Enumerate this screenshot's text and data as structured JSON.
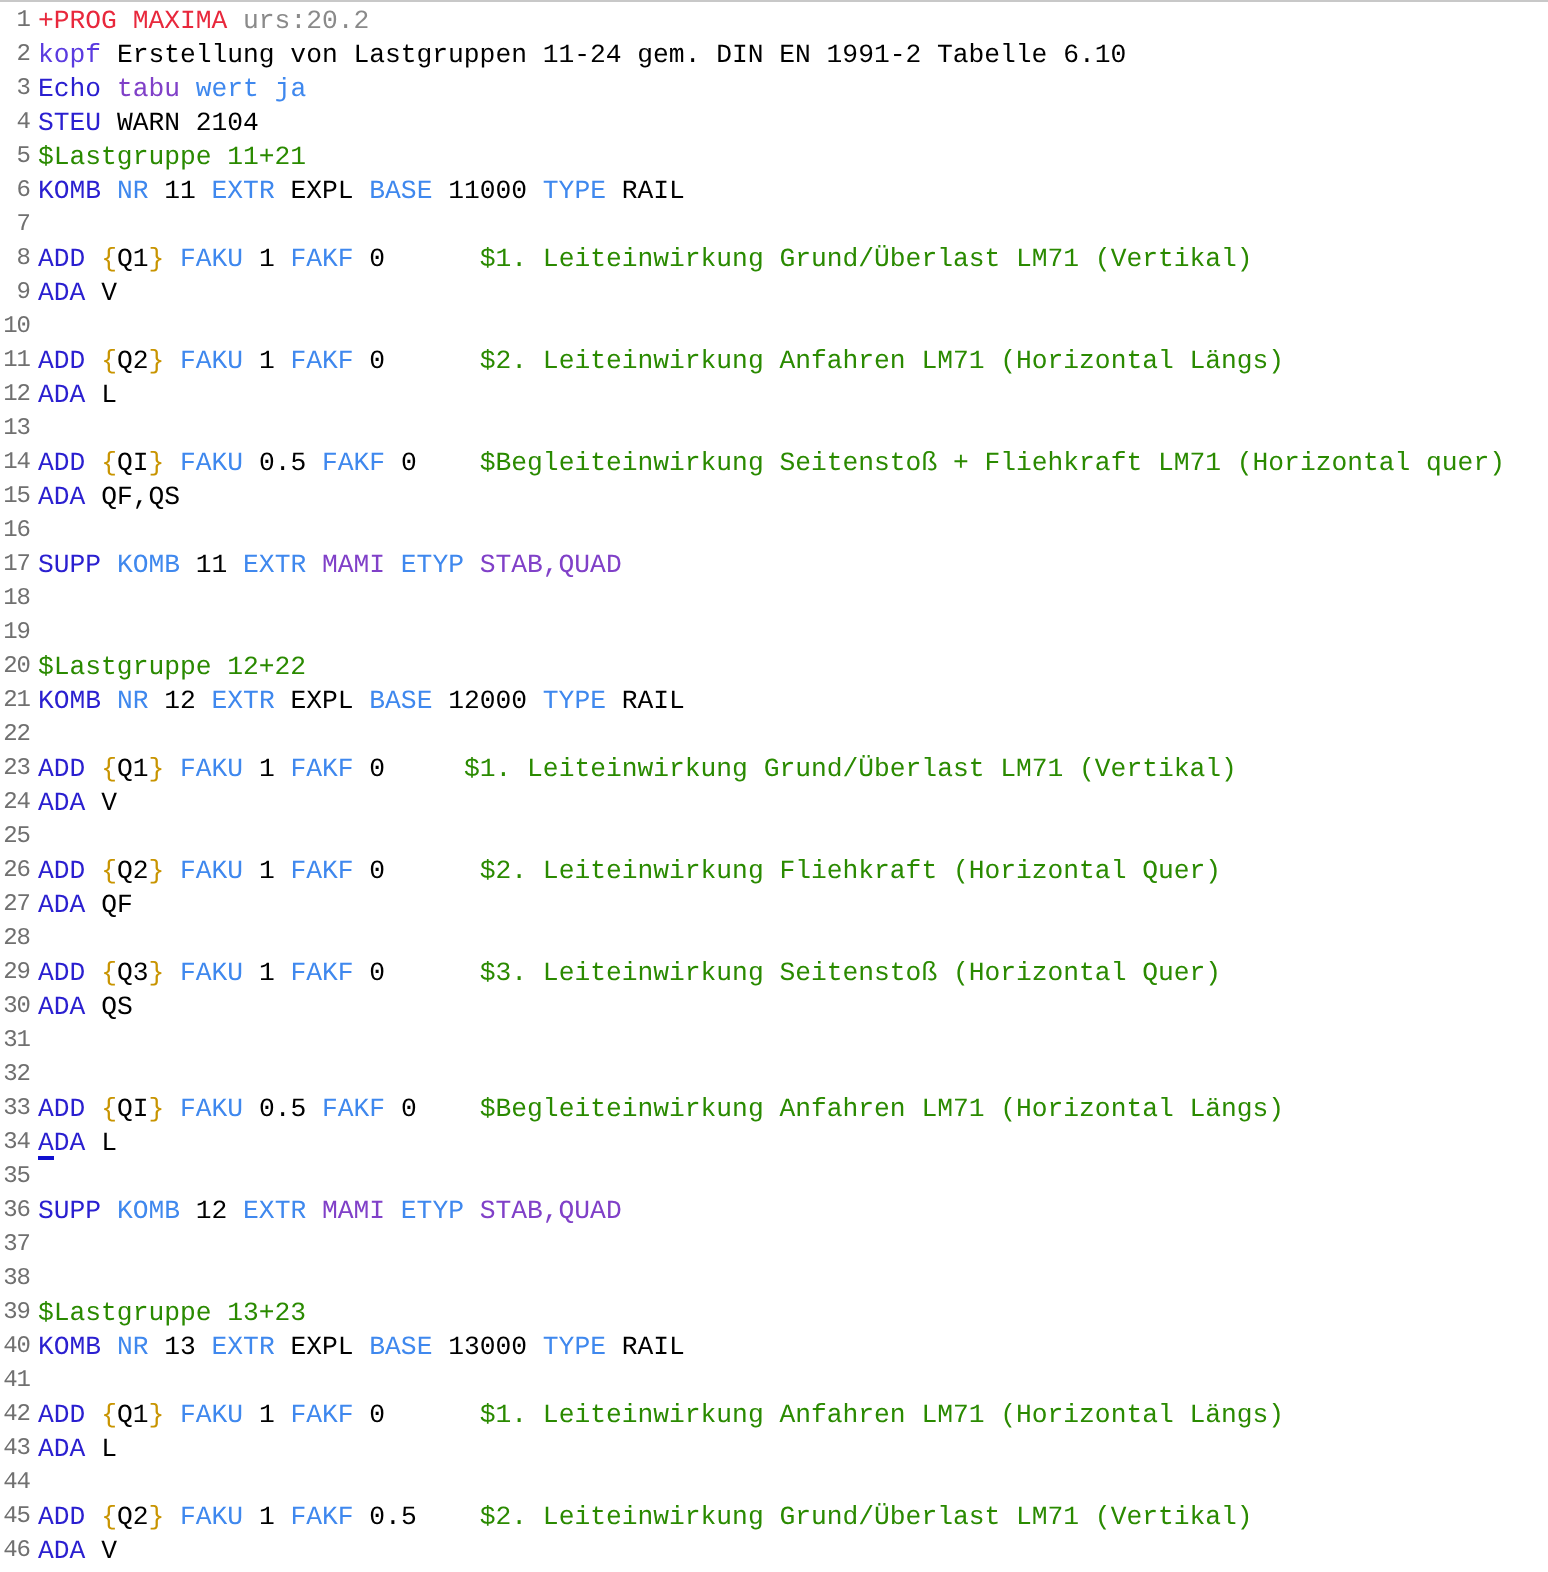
{
  "editor": {
    "lines": [
      {
        "number": "1",
        "tokens": [
          {
            "text": "+PROG MAXIMA",
            "kind": "head"
          },
          {
            "text": "urs:20.2",
            "kind": "version"
          }
        ]
      },
      {
        "number": "2",
        "tokens": [
          {
            "text": "kopf",
            "kind": "title"
          },
          {
            "text": "Erstellung von Lastgruppen 11-24 gem. DIN EN 1991-2 Tabelle 6.10",
            "kind": "plain"
          }
        ]
      },
      {
        "number": "3",
        "tokens": [
          {
            "text": "Echo",
            "kind": "command"
          },
          {
            "text": "tabu",
            "kind": "option"
          },
          {
            "text": "wert",
            "kind": "keyword"
          },
          {
            "text": "ja",
            "kind": "keyword"
          }
        ]
      },
      {
        "number": "4",
        "tokens": [
          {
            "text": "STEU",
            "kind": "command"
          },
          {
            "text": "WARN",
            "kind": "plain"
          },
          {
            "text": "2104",
            "kind": "plain"
          }
        ]
      },
      {
        "number": "5",
        "tokens": [
          {
            "text": "$Lastgruppe 11+21",
            "kind": "comment"
          }
        ]
      },
      {
        "number": "6",
        "tokens": [
          {
            "text": "KOMB",
            "kind": "command"
          },
          {
            "text": "NR",
            "kind": "keyword"
          },
          {
            "text": "11",
            "kind": "plain"
          },
          {
            "text": "EXTR",
            "kind": "keyword"
          },
          {
            "text": "EXPL",
            "kind": "plain"
          },
          {
            "text": "BASE",
            "kind": "keyword"
          },
          {
            "text": "11000",
            "kind": "plain"
          },
          {
            "text": "TYPE",
            "kind": "keyword"
          },
          {
            "text": "RAIL",
            "kind": "plain"
          }
        ]
      },
      {
        "number": "7"
      },
      {
        "number": "8",
        "tokens": [
          {
            "text": "ADD",
            "kind": "command"
          },
          {
            "text": "{",
            "kind": "brace"
          },
          {
            "text": "Q1",
            "kind": "plain",
            "join": true
          },
          {
            "text": "}",
            "kind": "brace",
            "join": true
          },
          {
            "text": "FAKU",
            "kind": "keyword"
          },
          {
            "text": "1",
            "kind": "plain"
          },
          {
            "text": "FAKF",
            "kind": "keyword"
          },
          {
            "text": "0",
            "kind": "plain"
          },
          {
            "text": "$1. Leiteinwirkung Grund/Überlast LM71 (Vertikal)",
            "kind": "comment",
            "narrow": false
          }
        ]
      },
      {
        "number": "9",
        "tokens": [
          {
            "text": "ADA",
            "kind": "command"
          },
          {
            "text": "V",
            "kind": "plain"
          }
        ]
      },
      {
        "number": "10"
      },
      {
        "number": "11",
        "tokens": [
          {
            "text": "ADD",
            "kind": "command"
          },
          {
            "text": "{",
            "kind": "brace"
          },
          {
            "text": "Q2",
            "kind": "plain",
            "join": true
          },
          {
            "text": "}",
            "kind": "brace",
            "join": true
          },
          {
            "text": "FAKU",
            "kind": "keyword"
          },
          {
            "text": "1",
            "kind": "plain"
          },
          {
            "text": "FAKF",
            "kind": "keyword"
          },
          {
            "text": "0",
            "kind": "plain"
          },
          {
            "text": "$2. Leiteinwirkung Anfahren LM71 (Horizontal Längs)",
            "kind": "comment",
            "narrow": false
          }
        ]
      },
      {
        "number": "12",
        "tokens": [
          {
            "text": "ADA",
            "kind": "command"
          },
          {
            "text": "L",
            "kind": "plain"
          }
        ]
      },
      {
        "number": "13"
      },
      {
        "number": "14",
        "tokens": [
          {
            "text": "ADD",
            "kind": "command"
          },
          {
            "text": "{",
            "kind": "brace"
          },
          {
            "text": "QI",
            "kind": "plain",
            "join": true
          },
          {
            "text": "}",
            "kind": "brace",
            "join": true
          },
          {
            "text": "FAKU",
            "kind": "keyword"
          },
          {
            "text": "0.5",
            "kind": "plain"
          },
          {
            "text": "FAKF",
            "kind": "keyword"
          },
          {
            "text": "0",
            "kind": "plain"
          },
          {
            "text": "$Begleiteinwirkung Seitenstoß + Fliehkraft LM71 (Horizontal quer)",
            "kind": "comment",
            "narrow": false
          }
        ]
      },
      {
        "number": "15",
        "tokens": [
          {
            "text": "ADA",
            "kind": "command"
          },
          {
            "text": "QF,QS",
            "kind": "plain"
          }
        ]
      },
      {
        "number": "16"
      },
      {
        "number": "17",
        "tokens": [
          {
            "text": "SUPP",
            "kind": "command"
          },
          {
            "text": "KOMB",
            "kind": "keyword"
          },
          {
            "text": "11",
            "kind": "plain"
          },
          {
            "text": "EXTR",
            "kind": "keyword"
          },
          {
            "text": "MAMI",
            "kind": "option"
          },
          {
            "text": "ETYP",
            "kind": "keyword"
          },
          {
            "text": "STAB,QUAD",
            "kind": "option"
          }
        ]
      },
      {
        "number": "18"
      },
      {
        "number": "19"
      },
      {
        "number": "20",
        "tokens": [
          {
            "text": "$Lastgruppe 12+22",
            "kind": "comment"
          }
        ]
      },
      {
        "number": "21",
        "tokens": [
          {
            "text": "KOMB",
            "kind": "command"
          },
          {
            "text": "NR",
            "kind": "keyword"
          },
          {
            "text": "12",
            "kind": "plain"
          },
          {
            "text": "EXTR",
            "kind": "keyword"
          },
          {
            "text": "EXPL",
            "kind": "plain"
          },
          {
            "text": "BASE",
            "kind": "keyword"
          },
          {
            "text": "12000",
            "kind": "plain"
          },
          {
            "text": "TYPE",
            "kind": "keyword"
          },
          {
            "text": "RAIL",
            "kind": "plain"
          }
        ]
      },
      {
        "number": "22"
      },
      {
        "number": "23",
        "tokens": [
          {
            "text": "ADD",
            "kind": "command"
          },
          {
            "text": "{",
            "kind": "brace"
          },
          {
            "text": "Q1",
            "kind": "plain",
            "join": true
          },
          {
            "text": "}",
            "kind": "brace",
            "join": true
          },
          {
            "text": "FAKU",
            "kind": "keyword"
          },
          {
            "text": "1",
            "kind": "plain"
          },
          {
            "text": "FAKF",
            "kind": "keyword"
          },
          {
            "text": "0",
            "kind": "plain"
          },
          {
            "text": "$1. Leiteinwirkung Grund/Überlast LM71 (Vertikal)",
            "kind": "comment",
            "narrow": true
          }
        ]
      },
      {
        "number": "24",
        "tokens": [
          {
            "text": "ADA",
            "kind": "command"
          },
          {
            "text": "V",
            "kind": "plain"
          }
        ]
      },
      {
        "number": "25"
      },
      {
        "number": "26",
        "tokens": [
          {
            "text": "ADD",
            "kind": "command"
          },
          {
            "text": "{",
            "kind": "brace"
          },
          {
            "text": "Q2",
            "kind": "plain",
            "join": true
          },
          {
            "text": "}",
            "kind": "brace",
            "join": true
          },
          {
            "text": "FAKU",
            "kind": "keyword"
          },
          {
            "text": "1",
            "kind": "plain"
          },
          {
            "text": "FAKF",
            "kind": "keyword"
          },
          {
            "text": "0",
            "kind": "plain"
          },
          {
            "text": "$2. Leiteinwirkung Fliehkraft (Horizontal Quer)",
            "kind": "comment",
            "narrow": false
          }
        ]
      },
      {
        "number": "27",
        "tokens": [
          {
            "text": "ADA",
            "kind": "command"
          },
          {
            "text": "QF",
            "kind": "plain"
          }
        ]
      },
      {
        "number": "28"
      },
      {
        "number": "29",
        "tokens": [
          {
            "text": "ADD",
            "kind": "command"
          },
          {
            "text": "{",
            "kind": "brace"
          },
          {
            "text": "Q3",
            "kind": "plain",
            "join": true
          },
          {
            "text": "}",
            "kind": "brace",
            "join": true
          },
          {
            "text": "FAKU",
            "kind": "keyword"
          },
          {
            "text": "1",
            "kind": "plain"
          },
          {
            "text": "FAKF",
            "kind": "keyword"
          },
          {
            "text": "0",
            "kind": "plain"
          },
          {
            "text": "$3. Leiteinwirkung Seitenstoß (Horizontal Quer)",
            "kind": "comment",
            "narrow": false
          }
        ]
      },
      {
        "number": "30",
        "tokens": [
          {
            "text": "ADA",
            "kind": "command"
          },
          {
            "text": "QS",
            "kind": "plain"
          }
        ]
      },
      {
        "number": "31"
      },
      {
        "number": "32"
      },
      {
        "number": "33",
        "tokens": [
          {
            "text": "ADD",
            "kind": "command"
          },
          {
            "text": "{",
            "kind": "brace"
          },
          {
            "text": "QI",
            "kind": "plain",
            "join": true
          },
          {
            "text": "}",
            "kind": "brace",
            "join": true
          },
          {
            "text": "FAKU",
            "kind": "keyword"
          },
          {
            "text": "0.5",
            "kind": "plain"
          },
          {
            "text": "FAKF",
            "kind": "keyword"
          },
          {
            "text": "0",
            "kind": "plain"
          },
          {
            "text": "$Begleiteinwirkung Anfahren LM71 (Horizontal Längs)",
            "kind": "comment",
            "narrow": false
          }
        ]
      },
      {
        "number": "34",
        "tokens": [
          {
            "text": "ADA",
            "kind": "command",
            "caret": true
          },
          {
            "text": "L",
            "kind": "plain"
          }
        ]
      },
      {
        "number": "35"
      },
      {
        "number": "36",
        "tokens": [
          {
            "text": "SUPP",
            "kind": "command"
          },
          {
            "text": "KOMB",
            "kind": "keyword"
          },
          {
            "text": "12",
            "kind": "plain"
          },
          {
            "text": "EXTR",
            "kind": "keyword"
          },
          {
            "text": "MAMI",
            "kind": "option"
          },
          {
            "text": "ETYP",
            "kind": "keyword"
          },
          {
            "text": "STAB,QUAD",
            "kind": "option"
          }
        ]
      },
      {
        "number": "37"
      },
      {
        "number": "38"
      },
      {
        "number": "39",
        "tokens": [
          {
            "text": "$Lastgruppe 13+23",
            "kind": "comment"
          }
        ]
      },
      {
        "number": "40",
        "tokens": [
          {
            "text": "KOMB",
            "kind": "command"
          },
          {
            "text": "NR",
            "kind": "keyword"
          },
          {
            "text": "13",
            "kind": "plain"
          },
          {
            "text": "EXTR",
            "kind": "keyword"
          },
          {
            "text": "EXPL",
            "kind": "plain"
          },
          {
            "text": "BASE",
            "kind": "keyword"
          },
          {
            "text": "13000",
            "kind": "plain"
          },
          {
            "text": "TYPE",
            "kind": "keyword"
          },
          {
            "text": "RAIL",
            "kind": "plain"
          }
        ]
      },
      {
        "number": "41"
      },
      {
        "number": "42",
        "tokens": [
          {
            "text": "ADD",
            "kind": "command"
          },
          {
            "text": "{",
            "kind": "brace"
          },
          {
            "text": "Q1",
            "kind": "plain",
            "join": true
          },
          {
            "text": "}",
            "kind": "brace",
            "join": true
          },
          {
            "text": "FAKU",
            "kind": "keyword"
          },
          {
            "text": "1",
            "kind": "plain"
          },
          {
            "text": "FAKF",
            "kind": "keyword"
          },
          {
            "text": "0",
            "kind": "plain"
          },
          {
            "text": "$1. Leiteinwirkung Anfahren LM71 (Horizontal Längs)",
            "kind": "comment",
            "narrow": false
          }
        ]
      },
      {
        "number": "43",
        "tokens": [
          {
            "text": "ADA",
            "kind": "command"
          },
          {
            "text": "L",
            "kind": "plain"
          }
        ]
      },
      {
        "number": "44"
      },
      {
        "number": "45",
        "tokens": [
          {
            "text": "ADD",
            "kind": "command"
          },
          {
            "text": "{",
            "kind": "brace"
          },
          {
            "text": "Q2",
            "kind": "plain",
            "join": true
          },
          {
            "text": "}",
            "kind": "brace",
            "join": true
          },
          {
            "text": "FAKU",
            "kind": "keyword"
          },
          {
            "text": "1",
            "kind": "plain"
          },
          {
            "text": "FAKF",
            "kind": "keyword"
          },
          {
            "text": "0.5",
            "kind": "plain"
          },
          {
            "text": "$2. Leiteinwirkung Grund/Überlast LM71 (Vertikal)",
            "kind": "comment",
            "narrow": false
          }
        ]
      },
      {
        "number": "46",
        "tokens": [
          {
            "text": "ADA",
            "kind": "command"
          },
          {
            "text": "V",
            "kind": "plain"
          }
        ]
      }
    ]
  }
}
